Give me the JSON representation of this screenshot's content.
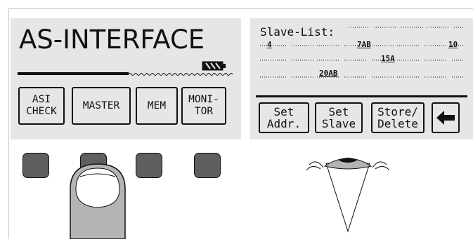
{
  "left_screen": {
    "title": "AS-INTERFACE",
    "softkeys": [
      {
        "label": "ASI\nCHECK"
      },
      {
        "label": "MASTER"
      },
      {
        "label": "MEM"
      },
      {
        "label": "MONI-\nTOR"
      }
    ],
    "battery_icon": "battery-icon"
  },
  "right_screen": {
    "header": "Slave-List:",
    "slaves": [
      {
        "label": "4"
      },
      {
        "label": "7AB"
      },
      {
        "label": "10"
      },
      {
        "label": "15A"
      },
      {
        "label": "20AB"
      }
    ],
    "softkeys": [
      {
        "label": "Set\nAddr."
      },
      {
        "label": "Set\nSlave"
      },
      {
        "label": "Store/\nDelete"
      },
      {
        "label": "←"
      }
    ]
  },
  "illustration": {
    "finger_icon": "finger-pressing-icon",
    "eye_icon": "eye-viewing-icon"
  },
  "colors": {
    "lcd_background": "#e6e6e6",
    "button_fill": "#5f5f5f",
    "finger_fill": "#b4b4b4"
  }
}
